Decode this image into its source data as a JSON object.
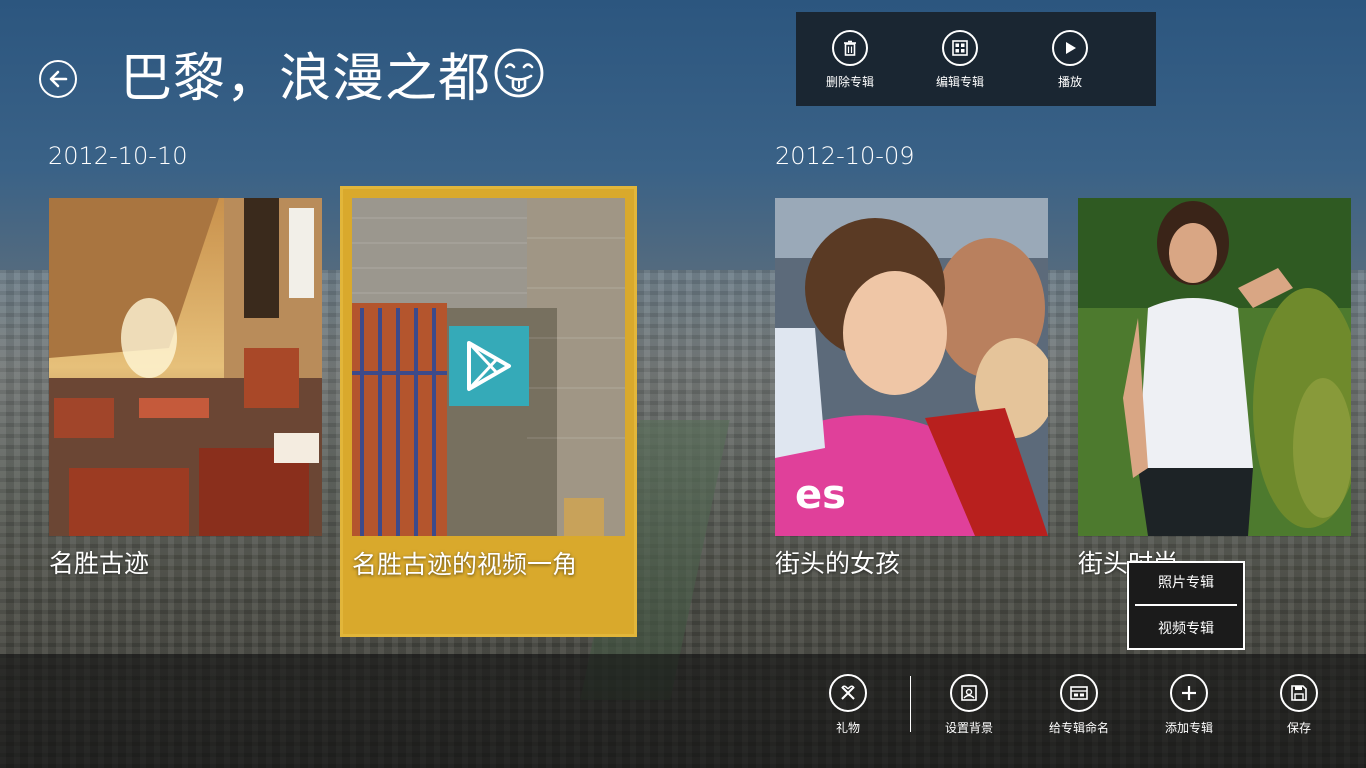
{
  "header": {
    "title": "巴黎，浪漫之都",
    "title_emoji": "tongue-out-face-icon"
  },
  "top_app_bar": {
    "buttons": [
      {
        "label": "删除专辑",
        "icon": "trash-icon"
      },
      {
        "label": "编辑专辑",
        "icon": "grid-edit-icon"
      },
      {
        "label": "播放",
        "icon": "play-icon"
      }
    ]
  },
  "groups": [
    {
      "date": "2012-10-10",
      "items": [
        {
          "caption": "名胜古迹",
          "type": "photo",
          "selected": false
        },
        {
          "caption": "名胜古迹的视频一角",
          "type": "video",
          "selected": true
        }
      ]
    },
    {
      "date": "2012-10-09",
      "items": [
        {
          "caption": "街头的女孩",
          "type": "photo",
          "selected": false
        },
        {
          "caption": "街头时尚",
          "type": "photo",
          "selected": false
        }
      ]
    }
  ],
  "flyout": {
    "items": [
      "照片专辑",
      "视频专辑"
    ]
  },
  "bottom_app_bar": {
    "buttons": [
      {
        "label": "礼物",
        "icon": "gift-x-icon"
      },
      {
        "label": "设置背景",
        "icon": "image-icon"
      },
      {
        "label": "给专辑命名",
        "icon": "rename-icon"
      },
      {
        "label": "添加专辑",
        "icon": "add-icon"
      },
      {
        "label": "保存",
        "icon": "save-icon"
      }
    ]
  },
  "colors": {
    "selection": "#d9a92c",
    "play_tile": "#35aab8",
    "app_bar": "#1a2632"
  }
}
